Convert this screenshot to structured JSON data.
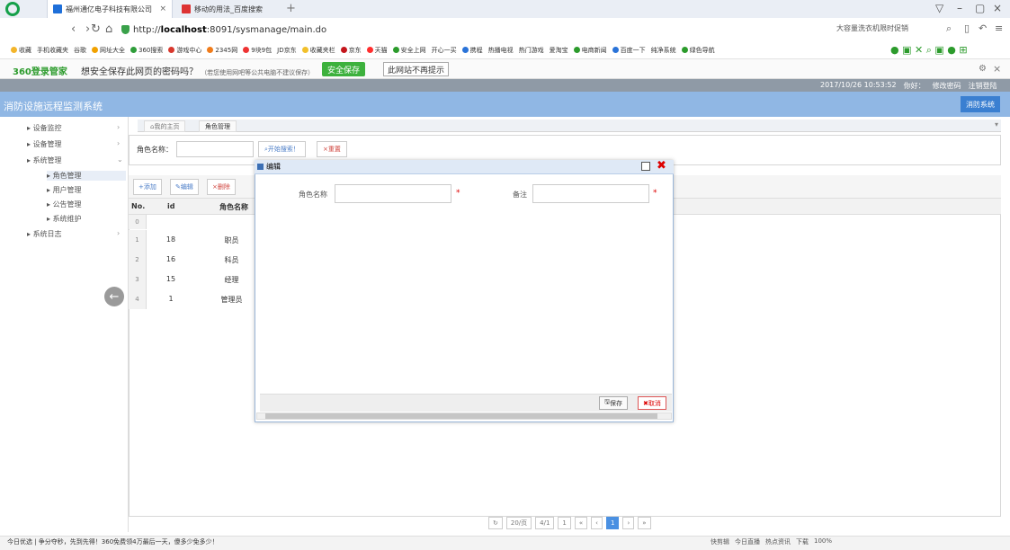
{
  "browser": {
    "tabs": [
      {
        "label": "福州通亿电子科技有限公司"
      },
      {
        "label": "移动的用法_百度搜索"
      }
    ],
    "url_prefix": "http://",
    "url_host": "localhost",
    "url_rest": ":8091/sysmanage/main.do",
    "search_hint": "大容量洗衣机限时促销",
    "bookmarks": [
      "收藏",
      "手机收藏夹",
      "谷歌",
      "网址大全",
      "360搜索",
      "游戏中心",
      "2345网",
      "9块9包",
      "JD京东",
      "收藏夹栏",
      "京东",
      "天猫",
      "安全上网",
      "开心一买",
      "携程",
      "热播电视",
      "热门游戏",
      "爱淘宝",
      "电商新闻",
      "百度一下",
      "纯净系统",
      "绿色导航"
    ]
  },
  "bar360": {
    "logo": "360登录管家",
    "question": "想安全保存此网页的密码吗？",
    "note": "（若您使用网吧等公共电脑不建议保存）",
    "safe_save": "安全保存",
    "no_more": "此网站不再提示"
  },
  "header": {
    "datetime": "2017/10/26 10:53:52",
    "greeting": "你好：",
    "change_pwd": "修改密码",
    "logout": "注销登陆",
    "system_title": "消防设施远程监测系统",
    "system_btn": "消防系统"
  },
  "sidebar": {
    "items": [
      {
        "label": "设备监控"
      },
      {
        "label": "设备管理"
      },
      {
        "label": "系统管理"
      }
    ],
    "sub_items": [
      {
        "label": "角色管理"
      },
      {
        "label": "用户管理"
      },
      {
        "label": "公告管理"
      },
      {
        "label": "系统维护"
      }
    ],
    "log_item": "系统日志"
  },
  "page_tabs": [
    "我的主页",
    "角色管理"
  ],
  "search": {
    "role_label": "角色名称：",
    "start": "开始搜索！",
    "reset": "重置"
  },
  "toolbar": {
    "add": "添加",
    "edit": "编辑",
    "delete": "删除"
  },
  "grid": {
    "headers": {
      "no": "No.",
      "id": "id",
      "name": "角色名称"
    },
    "rows": [
      {
        "no": "0",
        "id": "",
        "name": ""
      },
      {
        "no": "1",
        "id": "18",
        "name": "职员"
      },
      {
        "no": "2",
        "id": "16",
        "name": "科员"
      },
      {
        "no": "3",
        "id": "15",
        "name": "经理"
      },
      {
        "no": "4",
        "id": "1",
        "name": "管理员"
      }
    ]
  },
  "pager": {
    "per_page": "20/页",
    "pages": "4/1",
    "current": "1"
  },
  "modal": {
    "title": "编辑",
    "field1_label": "角色名称",
    "field2_label": "备注",
    "save": "保存",
    "cancel": "取消"
  },
  "status": {
    "left": "今日优选 | 争分夺秒，先到先得！360免费领4万最后一天，傻多少免多少！",
    "right": [
      "快剪辑",
      "今日直播",
      "热点资讯",
      "下载",
      "100%"
    ]
  }
}
